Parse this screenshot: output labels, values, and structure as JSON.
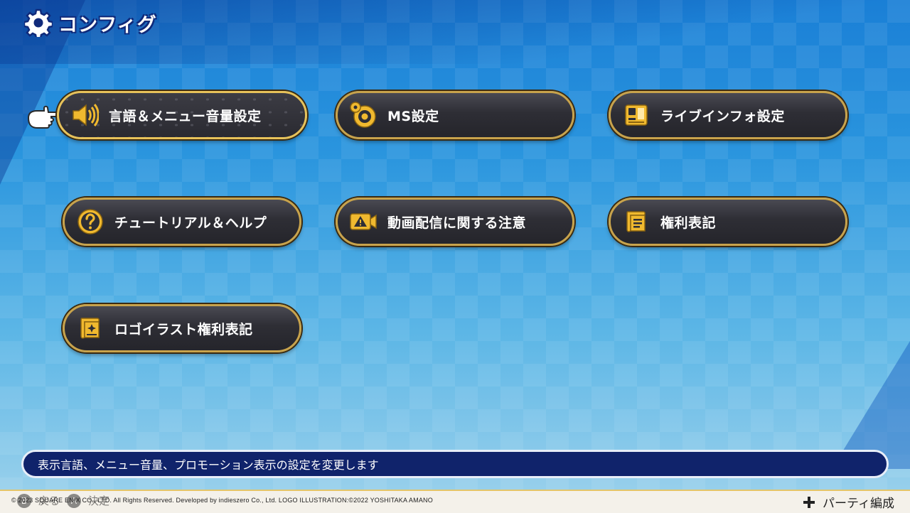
{
  "header": {
    "title": "コンフィグ",
    "icon": "gear-icon"
  },
  "menu": {
    "items": [
      {
        "label": "言語＆メニュー音量設定",
        "icon": "speaker-icon",
        "selected": true
      },
      {
        "label": "MS設定",
        "icon": "ms-settings-icon",
        "selected": false
      },
      {
        "label": "ライブインフォ設定",
        "icon": "live-info-icon",
        "selected": false
      },
      {
        "label": "チュートリアル＆ヘルプ",
        "icon": "help-icon",
        "selected": false
      },
      {
        "label": "動画配信に関する注意",
        "icon": "video-warning-icon",
        "selected": false
      },
      {
        "label": "権利表記",
        "icon": "scroll-icon",
        "selected": false
      },
      {
        "label": "ロゴイラスト権利表記",
        "icon": "scroll-sparkle-icon",
        "selected": false
      }
    ]
  },
  "description": {
    "text": "表示言語、メニュー音量、プロモーション表示の設定を変更します"
  },
  "footer": {
    "hint_back": "戻る",
    "hint_confirm": "決定",
    "copyright": "© 2023 SQUARE ENIX CO., LTD. All Rights Reserved. Developed by indieszero Co., Ltd.  LOGO ILLUSTRATION:©2022 YOSHITAKA AMANO",
    "party_label": "パーティ編成"
  },
  "colors": {
    "accent_gold": "#c8a34c",
    "button_dark": "#2e2e35",
    "desc_bar": "#10236b",
    "title_outline": "#102a7a"
  }
}
